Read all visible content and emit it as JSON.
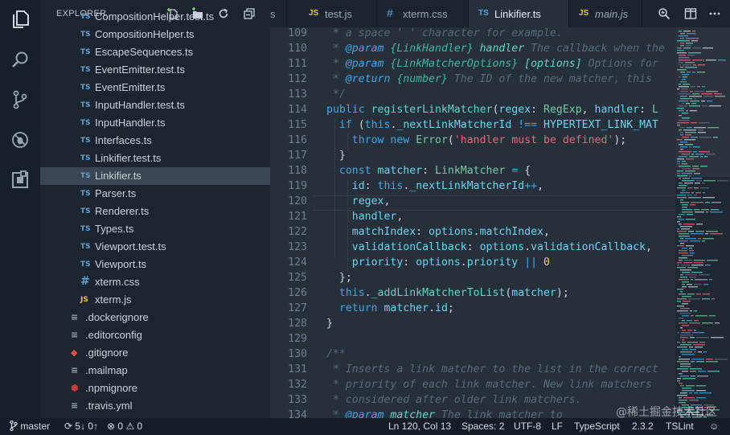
{
  "sidebar": {
    "title": "EXPLORER",
    "files": [
      {
        "name": "CompositionHelper.test.ts",
        "type": "ts"
      },
      {
        "name": "CompositionHelper.ts",
        "type": "ts"
      },
      {
        "name": "EscapeSequences.ts",
        "type": "ts"
      },
      {
        "name": "EventEmitter.test.ts",
        "type": "ts"
      },
      {
        "name": "EventEmitter.ts",
        "type": "ts"
      },
      {
        "name": "InputHandler.test.ts",
        "type": "ts"
      },
      {
        "name": "InputHandler.ts",
        "type": "ts"
      },
      {
        "name": "Interfaces.ts",
        "type": "ts"
      },
      {
        "name": "Linkifier.test.ts",
        "type": "ts"
      },
      {
        "name": "Linkifier.ts",
        "type": "ts",
        "selected": true
      },
      {
        "name": "Parser.ts",
        "type": "ts"
      },
      {
        "name": "Renderer.ts",
        "type": "ts"
      },
      {
        "name": "Types.ts",
        "type": "ts"
      },
      {
        "name": "Viewport.test.ts",
        "type": "ts"
      },
      {
        "name": "Viewport.ts",
        "type": "ts"
      },
      {
        "name": "xterm.css",
        "type": "css"
      },
      {
        "name": "xterm.js",
        "type": "js"
      },
      {
        "name": ".dockerignore",
        "type": "dot"
      },
      {
        "name": ".editorconfig",
        "type": "dot"
      },
      {
        "name": ".gitignore",
        "type": "git"
      },
      {
        "name": ".mailmap",
        "type": "dot"
      },
      {
        "name": ".npmignore",
        "type": "npm"
      },
      {
        "name": ".travis.yml",
        "type": "dot"
      }
    ]
  },
  "icons": {
    "ts": "TS",
    "js": "JS",
    "css": "#",
    "dot": "≡",
    "git": "◆",
    "npm": "⬢"
  },
  "tabs": [
    {
      "label": "s",
      "icon": ""
    },
    {
      "label": "test.js",
      "icon": "JS"
    },
    {
      "label": "xterm.css",
      "icon": "#"
    },
    {
      "label": "Linkifier.ts",
      "icon": "TS",
      "active": true
    },
    {
      "label": "main.js",
      "icon": "JS"
    }
  ],
  "code_lines": [
    {
      "n": "109",
      "html": "<span class=\"c\"> * a space ' ' character for example.</span>"
    },
    {
      "n": "110",
      "html": "<span class=\"c\"> * </span><span class=\"tag\">@param</span><span class=\"c\"> </span><span class=\"ty\">{LinkHandler}</span><span class=\"c\"> </span><span class=\"nm\"><i>handler</i></span><span class=\"c\"> The callback when the</span>"
    },
    {
      "n": "111",
      "html": "<span class=\"c\"> * </span><span class=\"tag\">@param</span><span class=\"c\"> </span><span class=\"ty\">{LinkMatcherOptions}</span><span class=\"c\"> </span><span class=\"nm\"><i>[options]</i></span><span class=\"c\"> Options for</span>"
    },
    {
      "n": "112",
      "html": "<span class=\"c\"> * </span><span class=\"tag\">@return</span><span class=\"c\"> </span><span class=\"ty\">{number}</span><span class=\"c\"> The ID of the new matcher, this</span>"
    },
    {
      "n": "113",
      "html": "<span class=\"c\"> */</span>"
    },
    {
      "n": "114",
      "html": "<span class=\"k\">public</span> <span class=\"f\">registerLinkMatcher</span>(<span class=\"pr\">regex</span>: <span class=\"t\">RegExp</span>, <span class=\"pr\">handler</span>: <span class=\"t\">L</span>"
    },
    {
      "n": "115",
      "html": "  <span class=\"k\">if</span> (<span class=\"k\">this</span>.<span class=\"pr\">_nextLinkMatcherId</span> <span class=\"k\">!==</span> <span class=\"pr\">HYPERTEXT_LINK_MAT</span>"
    },
    {
      "n": "116",
      "html": "    <span class=\"k\">throw</span> <span class=\"k\">new</span> <span class=\"t\">Error</span>(<span class=\"s\">'handler must be defined'</span>);"
    },
    {
      "n": "117",
      "html": "  }"
    },
    {
      "n": "118",
      "html": "  <span class=\"k\">const</span> <span class=\"pr\">matcher</span>: <span class=\"t\">LinkMatcher</span> <span class=\"k\">=</span> {"
    },
    {
      "n": "119",
      "html": "    <span class=\"pr\">id</span>: <span class=\"k\">this</span>.<span class=\"pr\">_nextLinkMatcherId</span><span class=\"k\">++</span>,"
    },
    {
      "n": "120",
      "html": "    <span class=\"pr\">regex</span>,"
    },
    {
      "n": "121",
      "html": "    <span class=\"pr\">handler</span>,"
    },
    {
      "n": "122",
      "html": "    <span class=\"pr\">matchIndex</span>: <span class=\"pr\">options</span>.<span class=\"pr\">matchIndex</span>,"
    },
    {
      "n": "123",
      "html": "    <span class=\"pr\">validationCallback</span>: <span class=\"pr\">options</span>.<span class=\"pr\">validationCallback</span>,"
    },
    {
      "n": "124",
      "html": "    <span class=\"pr\">priority</span>: <span class=\"pr\">options</span>.<span class=\"pr\">priority</span> <span class=\"k\">||</span> <span class=\"n\">0</span>"
    },
    {
      "n": "125",
      "html": "  };"
    },
    {
      "n": "126",
      "html": "  <span class=\"k\">this</span>.<span class=\"f\">_addLinkMatcherToList</span>(<span class=\"pr\">matcher</span>);"
    },
    {
      "n": "127",
      "html": "  <span class=\"k\">return</span> <span class=\"pr\">matcher</span>.<span class=\"pr\">id</span>;"
    },
    {
      "n": "128",
      "html": "}"
    },
    {
      "n": "129",
      "html": ""
    },
    {
      "n": "130",
      "html": "<span class=\"c\">/**</span>"
    },
    {
      "n": "131",
      "html": "<span class=\"c\"> * Inserts a link matcher to the list in the correct</span>"
    },
    {
      "n": "132",
      "html": "<span class=\"c\"> * priority of each link matcher. New link matchers</span>"
    },
    {
      "n": "133",
      "html": "<span class=\"c\"> * considered after older link matchers.</span>"
    },
    {
      "n": "134",
      "html": "<span class=\"c\"> * </span><span class=\"tag\">@param</span><span class=\"c\"> </span><span class=\"nm\"><i>matcher</i></span><span class=\"c\"> The link matcher to</span>"
    }
  ],
  "status": {
    "branch": "master",
    "sync": "5↓ 0↑",
    "errors": "0",
    "warnings": "0",
    "position": "Ln 120, Col 13",
    "spaces": "Spaces: 2",
    "encoding": "UTF-8",
    "eol": "LF",
    "language": "TypeScript",
    "version": "2.3.2",
    "linter": "TSLint"
  },
  "watermark": "@稀土掘金技术社区",
  "colors": {
    "accent_ts": "#5aa3d6",
    "accent_js": "#e2c744",
    "keyword": "#3fa6e8",
    "string": "#e46a78",
    "number": "#e8c66a"
  }
}
